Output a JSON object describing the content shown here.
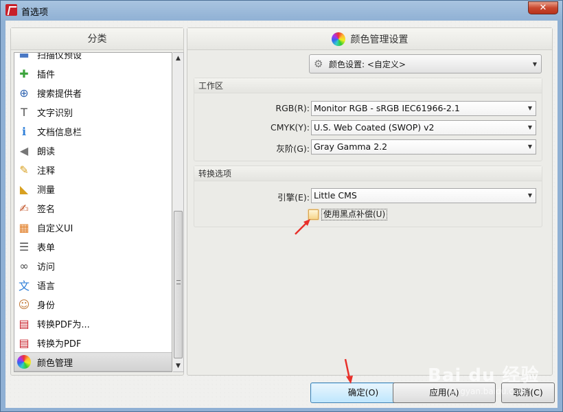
{
  "window": {
    "title": "首选项",
    "close_label": "✕"
  },
  "left": {
    "header": "分类",
    "items": [
      {
        "label": "扫描仪预设",
        "icon": "scanner-icon"
      },
      {
        "label": "插件",
        "icon": "puzzle-icon"
      },
      {
        "label": "搜索提供者",
        "icon": "binoculars-icon"
      },
      {
        "label": "文字识别",
        "icon": "ocr-icon"
      },
      {
        "label": "文档信息栏",
        "icon": "info-icon"
      },
      {
        "label": "朗读",
        "icon": "speaker-icon"
      },
      {
        "label": "注释",
        "icon": "annotation-icon"
      },
      {
        "label": "测量",
        "icon": "ruler-icon"
      },
      {
        "label": "签名",
        "icon": "signature-icon"
      },
      {
        "label": "自定义UI",
        "icon": "customize-ui-icon"
      },
      {
        "label": "表单",
        "icon": "form-icon"
      },
      {
        "label": "访问",
        "icon": "glasses-icon"
      },
      {
        "label": "语言",
        "icon": "language-icon"
      },
      {
        "label": "身份",
        "icon": "person-icon"
      },
      {
        "label": "转换PDF为...",
        "icon": "pdf-convert-from-icon"
      },
      {
        "label": "转换为PDF",
        "icon": "pdf-convert-to-icon"
      },
      {
        "label": "颜色管理",
        "icon": "color-wheel-icon",
        "selected": true
      }
    ]
  },
  "right": {
    "header": "颜色管理设置",
    "color_setting_value": "颜色设置: <自定义>",
    "workspace": {
      "title": "工作区",
      "rgb_label": "RGB(R):",
      "rgb_value": "Monitor RGB - sRGB IEC61966-2.1",
      "cmyk_label": "CMYK(Y):",
      "cmyk_value": "U.S. Web Coated (SWOP) v2",
      "gray_label": "灰阶(G):",
      "gray_value": "Gray Gamma 2.2"
    },
    "convert": {
      "title": "转换选项",
      "engine_label": "引擎(E):",
      "engine_value": "Little CMS",
      "bpc_label": "使用黑点补偿(U)",
      "bpc_checked": false
    }
  },
  "buttons": {
    "ok": "确定(O)",
    "apply": "应用(A)",
    "cancel": "取消(C)"
  },
  "watermark": {
    "main": "Bai du 经验",
    "sub": "jingyan.baidu.com"
  },
  "colors": {
    "accent_red": "#e8302a",
    "ok_border": "#3c7fb1"
  }
}
